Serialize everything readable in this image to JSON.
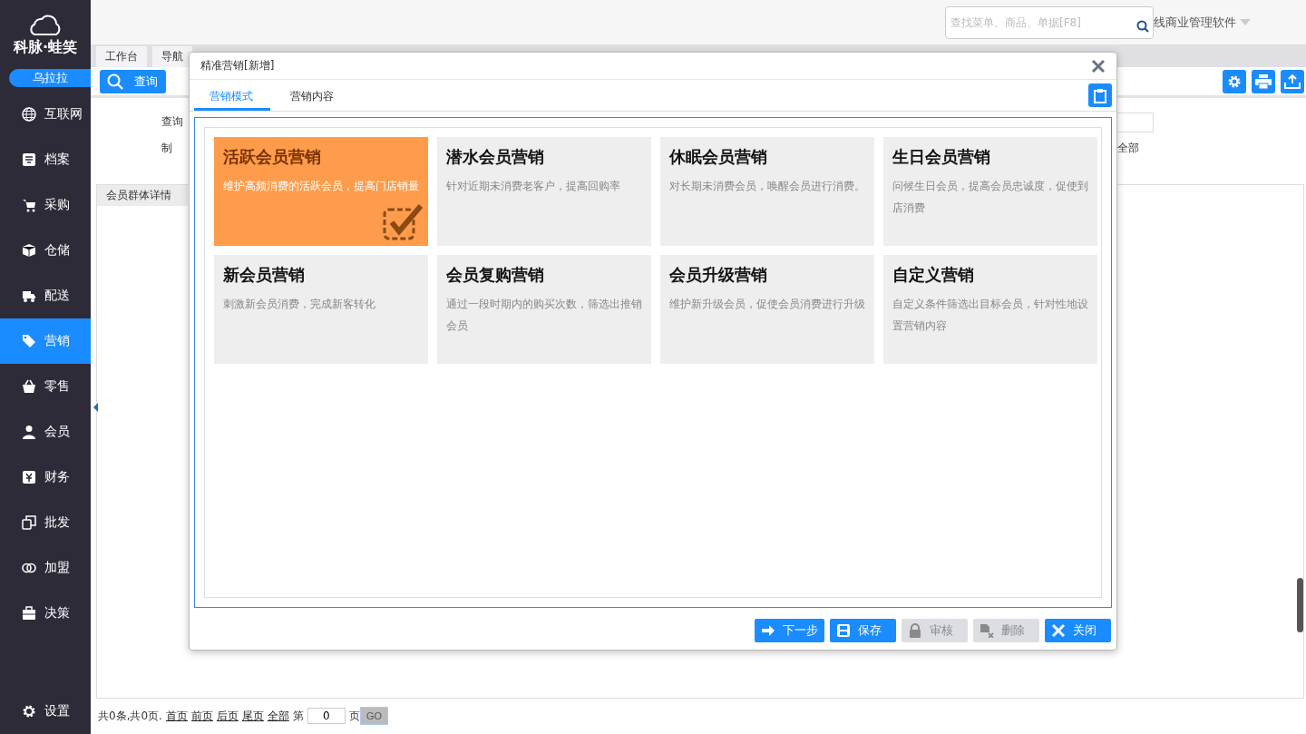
{
  "sidebar": {
    "logo": "科脉·蛙笑",
    "user": "乌拉拉",
    "items": [
      {
        "label": "互联网",
        "selected": false
      },
      {
        "label": "档案",
        "selected": false
      },
      {
        "label": "采购",
        "selected": false
      },
      {
        "label": "仓储",
        "selected": false
      },
      {
        "label": "配送",
        "selected": false
      },
      {
        "label": "营销",
        "selected": true
      },
      {
        "label": "零售",
        "selected": false
      },
      {
        "label": "会员",
        "selected": false
      },
      {
        "label": "财务",
        "selected": false
      },
      {
        "label": "批发",
        "selected": false
      },
      {
        "label": "加盟",
        "selected": false
      },
      {
        "label": "决策",
        "selected": false
      }
    ],
    "settings": "设置"
  },
  "header": {
    "search_placeholder": "查找菜单、商品、单据[F8]",
    "product": "线商业管理软件"
  },
  "page_tabs": [
    {
      "label": "工作台",
      "selected": false
    },
    {
      "label": "导航",
      "selected": false
    }
  ],
  "toolbar": {
    "query_button": "查询"
  },
  "form": {
    "labels": [
      "查询",
      "制"
    ],
    "option": "全部"
  },
  "grid": {
    "header": "会员群体详情"
  },
  "pager": {
    "summary": "共0条,共0页.",
    "links": [
      "首页",
      "前页",
      "后页",
      "尾页",
      "全部"
    ],
    "page_prefix": "第",
    "page_value": "0",
    "page_suffix": "页",
    "go": "GO"
  },
  "dialog": {
    "title": "精准营销[新增]",
    "tabs": [
      {
        "label": "营销模式",
        "selected": true
      },
      {
        "label": "营销内容",
        "selected": false
      }
    ],
    "modes": [
      {
        "title": "活跃会员营销",
        "desc": "维护高频消费的活跃会员，提高门店销量",
        "selected": true
      },
      {
        "title": "潜水会员营销",
        "desc": "针对近期未消费老客户，提高回购率",
        "selected": false
      },
      {
        "title": "休眠会员营销",
        "desc": "对长期未消费会员，唤醒会员进行消费。",
        "selected": false
      },
      {
        "title": "生日会员营销",
        "desc": "问候生日会员，提高会员忠诚度，促使到店消费",
        "selected": false
      },
      {
        "title": "新会员营销",
        "desc": "刺激新会员消费，完成新客转化",
        "selected": false
      },
      {
        "title": "会员复购营销",
        "desc": "通过一段时期内的购买次数，筛选出推销会员",
        "selected": false
      },
      {
        "title": "会员升级营销",
        "desc": "维护新升级会员，促使会员消费进行升级",
        "selected": false
      },
      {
        "title": "自定义营销",
        "desc": "自定义条件筛选出目标会员，针对性地设置营销内容",
        "selected": false
      }
    ],
    "buttons": [
      {
        "label": "下一步",
        "disabled": false
      },
      {
        "label": "保存",
        "disabled": false
      },
      {
        "label": "审核",
        "disabled": true
      },
      {
        "label": "删除",
        "disabled": true
      },
      {
        "label": "关闭",
        "disabled": false
      }
    ]
  }
}
